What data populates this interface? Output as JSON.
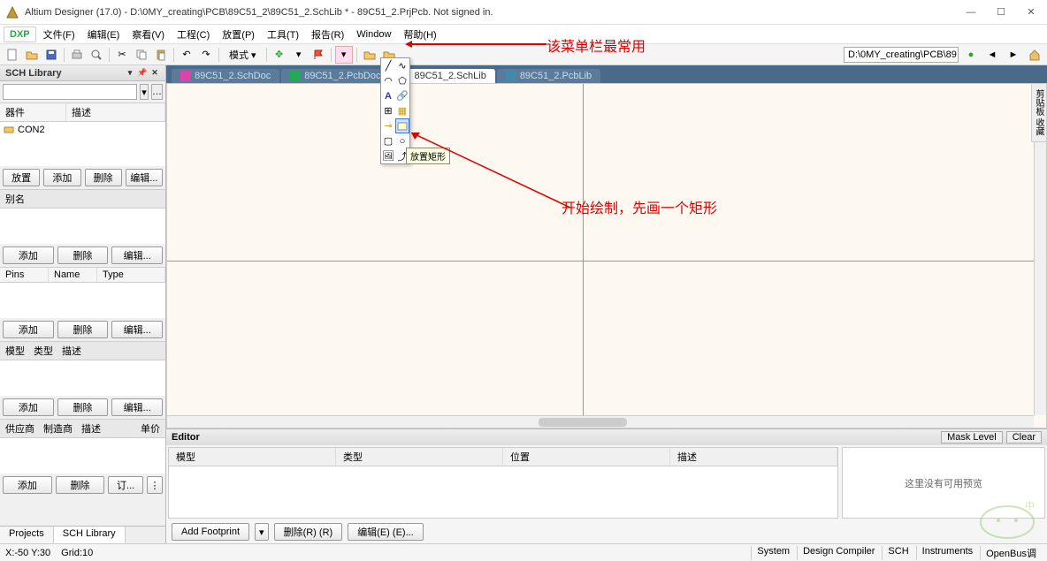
{
  "title": "Altium Designer (17.0) - D:\\0MY_creating\\PCB\\89C51_2\\89C51_2.SchLib * - 89C51_2.PrjPcb. Not signed in.",
  "menubar": {
    "dxp": "DXP",
    "items": [
      "文件(F)",
      "编辑(E)",
      "察看(V)",
      "工程(C)",
      "放置(P)",
      "工具(T)",
      "报告(R)",
      "Window",
      "帮助(H)"
    ]
  },
  "toolbar": {
    "mode": "模式 ▾",
    "path": "D:\\0MY_creating\\PCB\\89"
  },
  "leftpanel": {
    "title": "SCH Library",
    "cols1": {
      "c1": "器件",
      "c2": "描述"
    },
    "item1": "CON2",
    "btns1": [
      "放置",
      "添加",
      "删除",
      "编辑..."
    ],
    "aliasHdr": "别名",
    "btns2": [
      "添加",
      "删除",
      "编辑..."
    ],
    "cols2": {
      "c1": "Pins",
      "c2": "Name",
      "c3": "Type"
    },
    "btns3": [
      "添加",
      "删除",
      "编辑..."
    ],
    "modelHdr": {
      "a": "模型",
      "b": "类型",
      "c": "描述"
    },
    "btns4": [
      "添加",
      "删除",
      "编辑..."
    ],
    "supHdr": {
      "a": "供应商",
      "b": "制造商",
      "c": "描述",
      "d": "单价"
    },
    "btns5": [
      "添加",
      "删除",
      "订..."
    ],
    "tabs": [
      "Projects",
      "SCH Library"
    ]
  },
  "doctabs": [
    {
      "label": "89C51_2.SchDoc",
      "active": false
    },
    {
      "label": "89C51_2.PcbDoc",
      "active": false
    },
    {
      "label": "89C51_2.SchLib",
      "active": true
    },
    {
      "label": "89C51_2.PcbLib",
      "active": false
    }
  ],
  "tooltip": "放置矩形",
  "annotations": {
    "a1": "该菜单栏最常用",
    "a2": "开始绘制，先画一个矩形"
  },
  "editor": {
    "title": "Editor",
    "maskBtn": "Mask Level",
    "clearBtn": "Clear",
    "cols": [
      "模型",
      "类型",
      "位置",
      "描述"
    ],
    "preview": "这里没有可用预览",
    "footer": [
      "Add Footprint",
      "删除(R) (R)",
      "编辑(E) (E)..."
    ]
  },
  "statusbar": {
    "coords": "X:-50 Y:30",
    "grid": "Grid:10",
    "links": [
      "System",
      "Design Compiler",
      "SCH",
      "Instruments",
      "OpenBus调"
    ]
  },
  "vtab": "剪贴板 收藏"
}
